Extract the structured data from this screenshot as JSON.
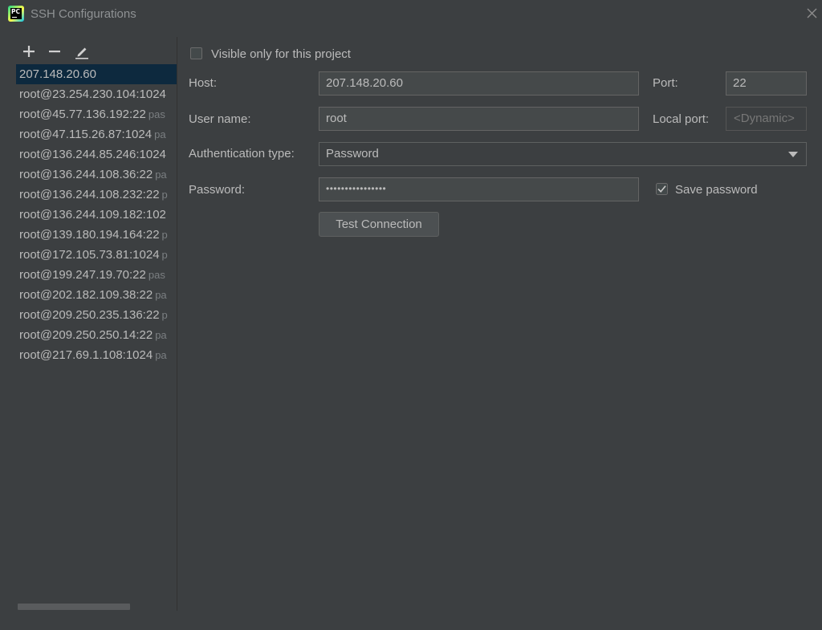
{
  "window": {
    "title": "SSH Configurations",
    "app_icon": "pycharm-logo",
    "app_icon_text": "PC"
  },
  "toolbar": {
    "add_icon": "plus-icon",
    "remove_icon": "minus-icon",
    "edit_icon": "pencil-icon"
  },
  "connections": [
    {
      "name": "207.148.20.60",
      "sub": "",
      "selected": true
    },
    {
      "name": "root@23.254.230.104:1024",
      "sub": ""
    },
    {
      "name": "root@45.77.136.192:22",
      "sub": "pas"
    },
    {
      "name": "root@47.115.26.87:1024",
      "sub": "pa"
    },
    {
      "name": "root@136.244.85.246:1024",
      "sub": ""
    },
    {
      "name": "root@136.244.108.36:22",
      "sub": "pa"
    },
    {
      "name": "root@136.244.108.232:22",
      "sub": "p"
    },
    {
      "name": "root@136.244.109.182:102",
      "sub": ""
    },
    {
      "name": "root@139.180.194.164:22",
      "sub": "p"
    },
    {
      "name": "root@172.105.73.81:1024",
      "sub": "p"
    },
    {
      "name": "root@199.247.19.70:22",
      "sub": "pas"
    },
    {
      "name": "root@202.182.109.38:22",
      "sub": "pa"
    },
    {
      "name": "root@209.250.235.136:22",
      "sub": "p"
    },
    {
      "name": "root@209.250.250.14:22",
      "sub": "pa"
    },
    {
      "name": "root@217.69.1.108:1024",
      "sub": "pa"
    }
  ],
  "form": {
    "visible_only_label": "Visible only for this project",
    "visible_only_checked": false,
    "host_label": "Host:",
    "host_value": "207.148.20.60",
    "port_label": "Port:",
    "port_value": "22",
    "username_label": "User name:",
    "username_value": "root",
    "local_port_label": "Local port:",
    "local_port_placeholder": "<Dynamic>",
    "auth_type_label": "Authentication type:",
    "auth_type_value": "Password",
    "password_label": "Password:",
    "password_mask": "••••••••••••••••",
    "save_password_label": "Save password",
    "save_password_checked": true,
    "test_connection_label": "Test Connection"
  },
  "colors": {
    "background": "#3c3f41",
    "selection": "#0d293e",
    "text": "#bbbbbb",
    "field_bg": "#45494a",
    "border": "#646464"
  }
}
